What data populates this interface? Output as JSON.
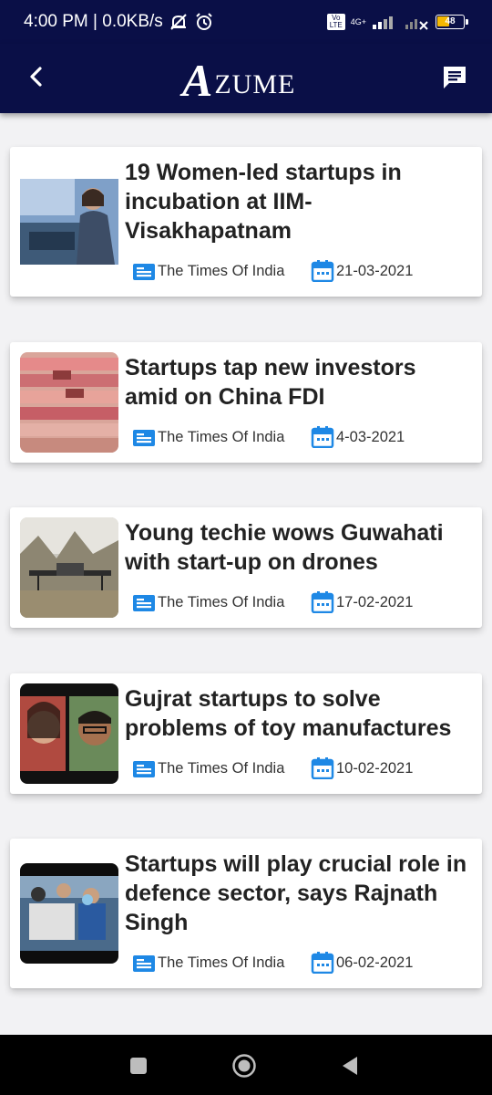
{
  "status_bar": {
    "time_speed": "4:00 PM | 0.0KB/s",
    "network_label": "4G+",
    "volte_label": "Vo LTE",
    "battery": "48"
  },
  "app_bar": {
    "logo_initial": "A",
    "logo_text": "ZUME"
  },
  "colors": {
    "header_bg": "#0a0f47",
    "accent_icon": "#1e88e5",
    "title_text": "#222222"
  },
  "articles": [
    {
      "title": "19 Women-led startups in incubation at IIM-Visakhapatnam",
      "source": "The Times Of India",
      "date": "21-03-2021",
      "source_icon": "newspaper-icon",
      "date_icon": "calendar-icon"
    },
    {
      "title": "Startups tap new investors amid on China FDI",
      "source": "The Times Of India",
      "date": "4-03-2021",
      "source_icon": "newspaper-icon",
      "date_icon": "calendar-icon"
    },
    {
      "title": "Young techie wows Guwahati with start-up on drones",
      "source": "The Times Of India",
      "date": "17-02-2021",
      "source_icon": "newspaper-icon",
      "date_icon": "calendar-icon"
    },
    {
      "title": "Gujrat startups to solve problems of toy manufactures",
      "source": "The Times Of India",
      "date": "10-02-2021",
      "source_icon": "newspaper-icon",
      "date_icon": "calendar-icon"
    },
    {
      "title": "Startups will play crucial role in defence sector, says Rajnath Singh",
      "source": "The Times Of India",
      "date": "06-02-2021",
      "source_icon": "newspaper-icon",
      "date_icon": "calendar-icon"
    }
  ]
}
